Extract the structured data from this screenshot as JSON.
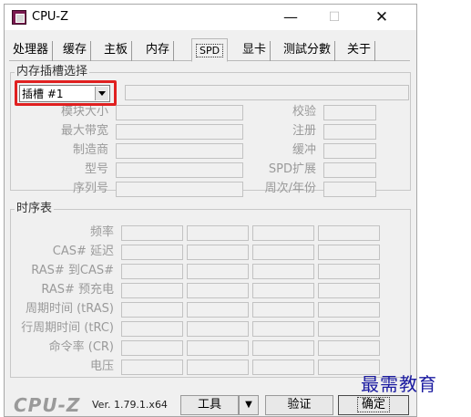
{
  "window": {
    "title": "CPU-Z",
    "minimize": "—",
    "maximize": "☐",
    "close": "✕"
  },
  "tabs": [
    {
      "label": "处理器"
    },
    {
      "label": "缓存"
    },
    {
      "label": "主板"
    },
    {
      "label": "内存"
    },
    {
      "label": "SPD"
    },
    {
      "label": "显卡"
    },
    {
      "label": "测試分數"
    },
    {
      "label": "关于"
    }
  ],
  "slot_group": {
    "title": "内存插槽选择",
    "slot_select": {
      "value": "插槽 #1"
    },
    "fields_left": [
      {
        "label": "模块大小",
        "value": ""
      },
      {
        "label": "最大带宽",
        "value": ""
      },
      {
        "label": "制造商",
        "value": ""
      },
      {
        "label": "型号",
        "value": ""
      },
      {
        "label": "序列号",
        "value": ""
      }
    ],
    "fields_right": [
      {
        "label": "校验",
        "value": ""
      },
      {
        "label": "注册",
        "value": ""
      },
      {
        "label": "缓冲",
        "value": ""
      },
      {
        "label": "SPD扩展",
        "value": ""
      },
      {
        "label": "周次/年份",
        "value": ""
      }
    ]
  },
  "timing_group": {
    "title": "时序表",
    "rows": [
      {
        "label": "频率"
      },
      {
        "label": "CAS# 延迟"
      },
      {
        "label": "RAS# 到CAS#"
      },
      {
        "label": "RAS# 预充电"
      },
      {
        "label": "周期时间 (tRAS)"
      },
      {
        "label": "行周期时间 (tRC)"
      },
      {
        "label": "命令率 (CR)"
      },
      {
        "label": "电压"
      }
    ]
  },
  "footer": {
    "logo": "CPU-Z",
    "version": "Ver. 1.79.1.x64",
    "tools_button": "工具",
    "tools_arrow": "▼",
    "verify_button": "验证",
    "ok_button": "确定"
  },
  "watermark": "最需教育",
  "colors": {
    "highlight_border": "#e02020",
    "watermark": "#1a1aa0"
  }
}
